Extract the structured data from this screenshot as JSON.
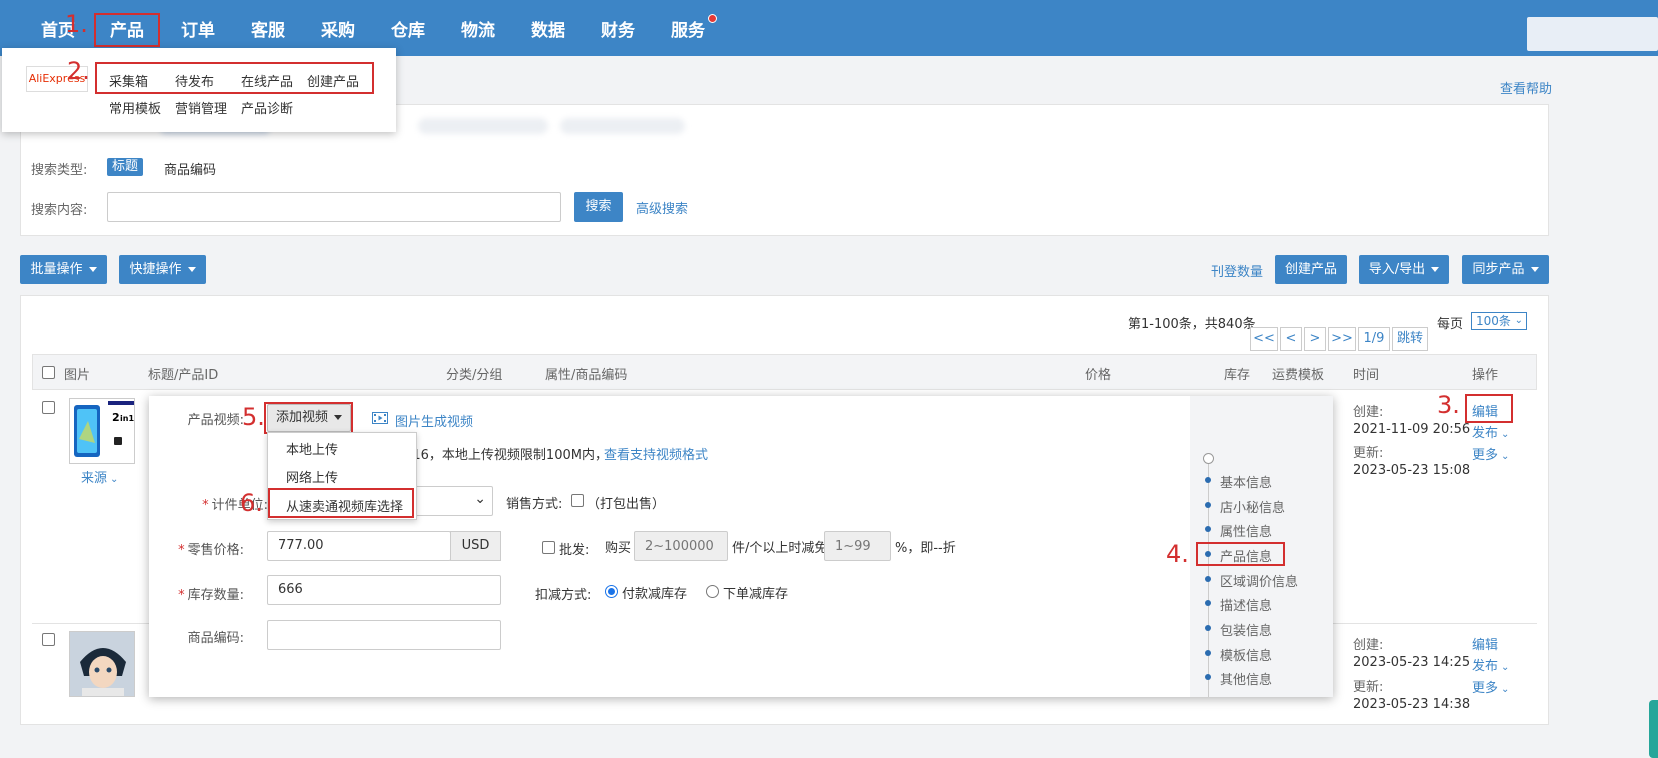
{
  "nav": {
    "items": [
      "首页",
      "产品",
      "订单",
      "客服",
      "采购",
      "仓库",
      "物流",
      "数据",
      "财务",
      "服务"
    ]
  },
  "dropdown": {
    "logo": "AliExpress",
    "row1": [
      "采集箱",
      "待发布",
      "在线产品",
      "创建产品"
    ],
    "row2": [
      "常用模板",
      "营销管理",
      "产品诊断"
    ]
  },
  "help_link": "查看帮助",
  "search": {
    "type_label": "搜索类型:",
    "type_active": "标题",
    "type_other": "商品编码",
    "content_label": "搜索内容:",
    "input_value": "",
    "search_button": "搜索",
    "advanced_link": "高级搜索"
  },
  "toolbar": {
    "batch": "批量操作",
    "quick": "快捷操作",
    "listing_count": "刊登数量",
    "create": "创建产品",
    "import_export": "导入/导出",
    "sync": "同步产品"
  },
  "pagination": {
    "summary": "第1-100条，共840条",
    "first": "<<",
    "prev": "<",
    "next": ">",
    "last": ">>",
    "page": "1/9",
    "jump": "跳转",
    "per_page_label": "每页",
    "per_page_value": "100条"
  },
  "table": {
    "headers": {
      "image": "图片",
      "title": "标题/产品ID",
      "category": "分类/分组",
      "attributes": "属性/商品编码",
      "price": "价格",
      "stock": "库存",
      "shipping": "运费模板",
      "time": "时间",
      "actions": "操作"
    },
    "source_link": "来源",
    "rows": [
      {
        "created_label": "创建:",
        "created": "2021-11-09 20:56",
        "updated_label": "更新:",
        "updated": "2023-05-23 15:08",
        "edit": "编辑",
        "publish": "发布",
        "more": "更多"
      },
      {
        "created_label": "创建:",
        "created": "2023-05-23 14:25",
        "updated_label": "更新:",
        "updated": "2023-05-23 14:38",
        "edit": "编辑",
        "publish": "发布",
        "more": "更多"
      }
    ]
  },
  "editor": {
    "video_label": "产品视频:",
    "add_video": "添加视频",
    "image_to_video": "图片生成视频",
    "video_menu": [
      "本地上传",
      "网络上传",
      "从速卖通视频库选择"
    ],
    "video_note": ":16，本地上传视频限制100M内，",
    "video_formats_link": "查看支持视频格式",
    "unit_label": "计件单位:",
    "sale_mode_label": "销售方式:",
    "sale_mode_option": "（打包出售）",
    "price_label": "零售价格:",
    "price_value": "777.00",
    "currency": "USD",
    "wholesale_label": "批发:",
    "buy_label": "购买",
    "qty_placeholder": "2~100000",
    "qty_suffix": "件/个以上时减免",
    "discount_placeholder": "1~99",
    "discount_suffix": "%，即--折",
    "stock_label": "库存数量:",
    "stock_value": "666",
    "deduct_label": "扣减方式:",
    "deduct_pay": "付款减库存",
    "deduct_order": "下单减库存",
    "sku_label": "商品编码:",
    "sku_value": "",
    "steps": [
      "基本信息",
      "店小秘信息",
      "属性信息",
      "产品信息",
      "区域调价信息",
      "描述信息",
      "包装信息",
      "模板信息",
      "其他信息"
    ]
  },
  "annotations": [
    "1.",
    "2.",
    "3.",
    "4.",
    "5.",
    "6."
  ],
  "colors": {
    "brand": "#3d85c6",
    "annotation": "#d32f2f"
  }
}
